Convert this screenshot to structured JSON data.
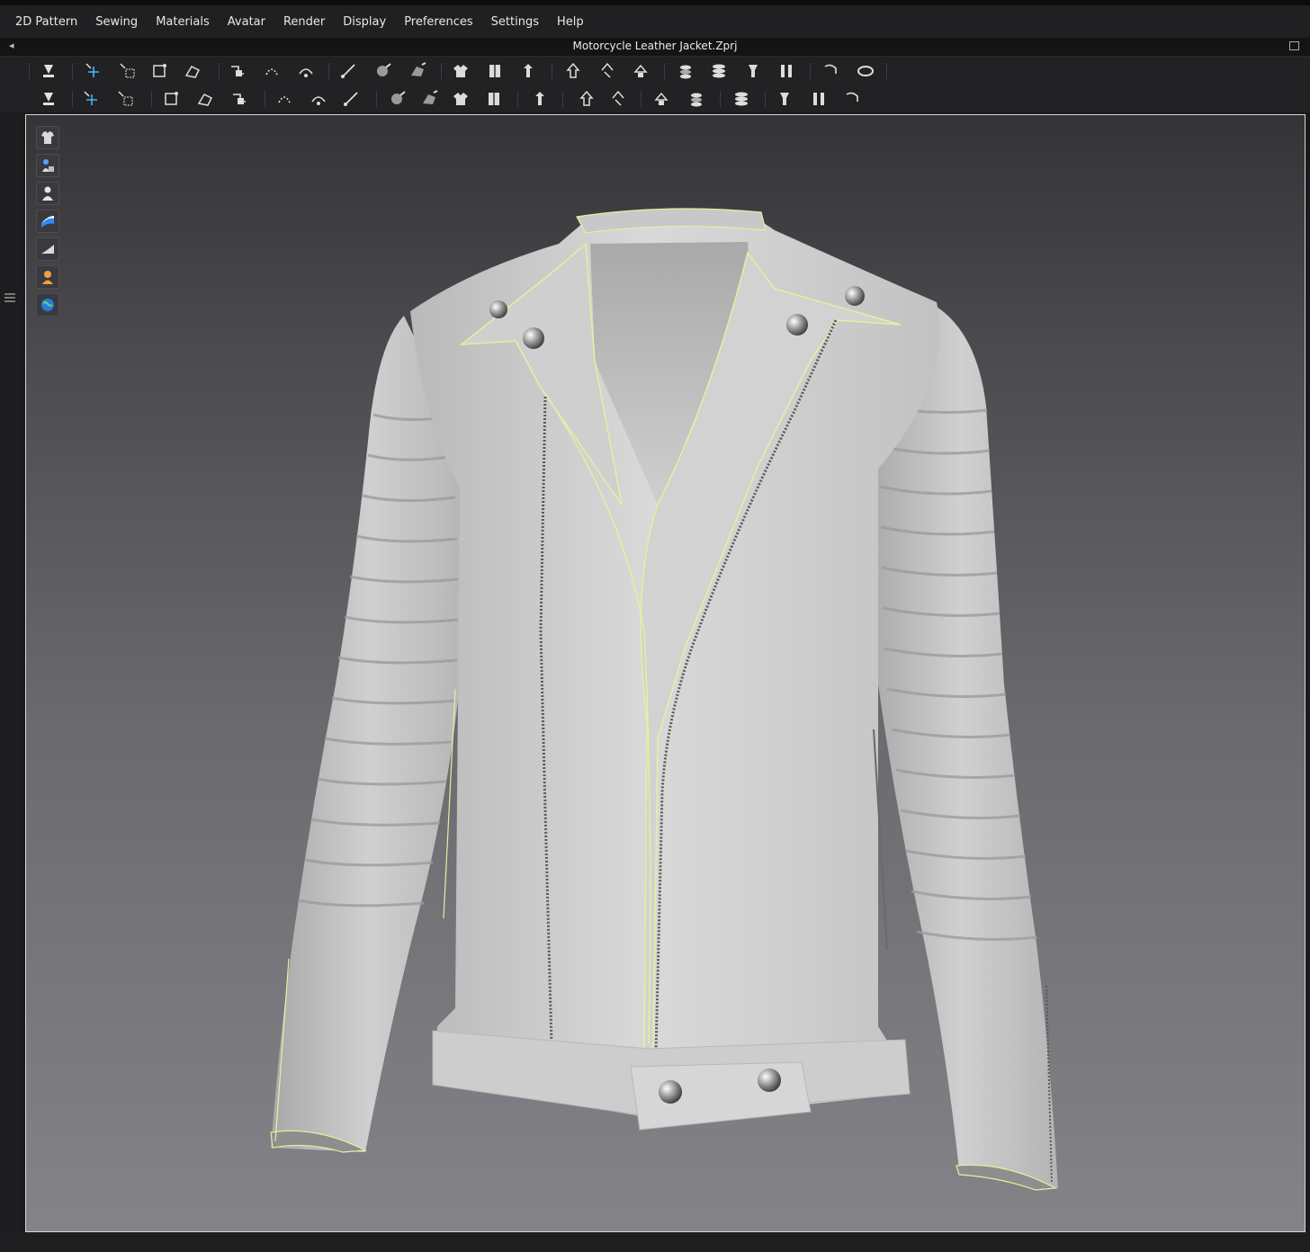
{
  "menu": {
    "items": [
      "2D Pattern",
      "Sewing",
      "Materials",
      "Avatar",
      "Render",
      "Display",
      "Preferences",
      "Settings",
      "Help"
    ]
  },
  "window": {
    "title": "Motorcycle Leather Jacket.Zprj"
  },
  "toolbar1": {
    "tools": [
      "simulation-icon",
      "transform-pattern-icon",
      "select-mesh-icon",
      "box-select-icon",
      "edit-pattern-icon",
      "fold-arrangement-icon",
      "tack-icon",
      "tack-on-avatar-icon",
      "tape-icon",
      "pin-icon",
      "brush-pin-icon",
      "fold-icon",
      "freeze-icon",
      "deactivate-icon",
      "strengthen-icon",
      "shrinkage-icon",
      "layer-icon",
      "layer-clone-icon",
      "arrangement-icon",
      "avatar-measure-icon",
      "tape-measure-icon",
      "circumference-icon",
      "length-icon"
    ]
  },
  "toolbar2": {
    "tools": [
      "pose-icon",
      "fit-suit-icon",
      "avatar-edit-icon",
      "select-trims-icon",
      "pin-trims-icon",
      "garment-fit-icon",
      "stitch-icon",
      "puckering-icon",
      "topstitch-icon",
      "button-icon",
      "buttonhole-icon",
      "gather-icon",
      "select-button-icon",
      "zipper-icon",
      "graphic-icon",
      "texture-icon",
      "select-graphic-icon",
      "graphic-transform-icon",
      "measure-icon",
      "fold-tool-icon",
      "shape-icon",
      "animate-icon"
    ]
  },
  "viewport": {
    "side_tools": [
      "garment-view-icon",
      "avatar-texture-icon",
      "avatar-view-icon",
      "fabric-texture-icon",
      "surface-icon",
      "skin-icon",
      "environment-icon"
    ],
    "background_color": "#5e5e62",
    "garment_color": "#d4d4d4",
    "seam_highlight_color": "#e4f0a0"
  }
}
